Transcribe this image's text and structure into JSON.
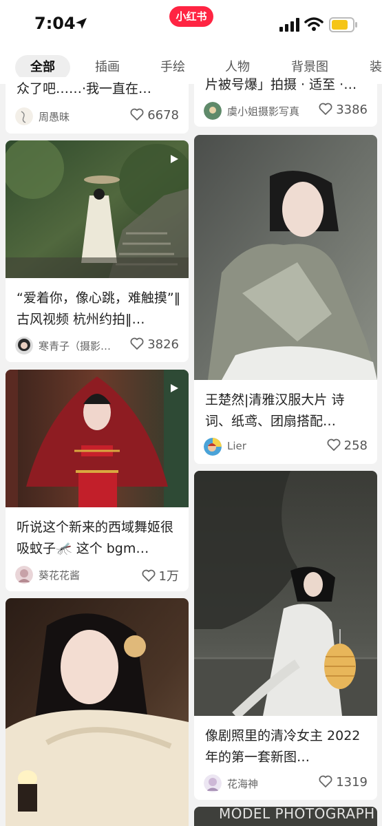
{
  "status_bar": {
    "time": "7:04",
    "brand": "小红书"
  },
  "tabs": [
    "全部",
    "插画",
    "手绘",
    "人物",
    "背景图",
    "装"
  ],
  "feed": {
    "left": [
      {
        "title": "众了吧……·我一直在…",
        "author": "周愚昧",
        "likes": "6678"
      },
      {
        "title": "“爱着你，像心跳，难触摸”‖古风视频 杭州约拍‖…",
        "author": "寒青子（摄影…",
        "likes": "3826"
      },
      {
        "title": "听说这个新来的西域舞姬很吸蚊子🦟 这个 bgm…",
        "author": "葵花花酱",
        "likes": "1万"
      }
    ],
    "right": [
      {
        "title": "片被号爆」拍摄 · 适至 ·…",
        "author": "虞小姐摄影写真",
        "likes": "3386"
      },
      {
        "title": "王楚然|清雅汉服大片 诗词、纸鸢、团扇搭配…",
        "author": "Lier",
        "likes": "258"
      },
      {
        "title": "像剧照里的清冷女主 2022年的第一套新图…",
        "author": "花海神",
        "likes": "1319"
      }
    ]
  },
  "watermark": "MODEL PHOTOGRAPH",
  "colors": {
    "brand": "#ff2442",
    "background": "#f2f2f2"
  }
}
